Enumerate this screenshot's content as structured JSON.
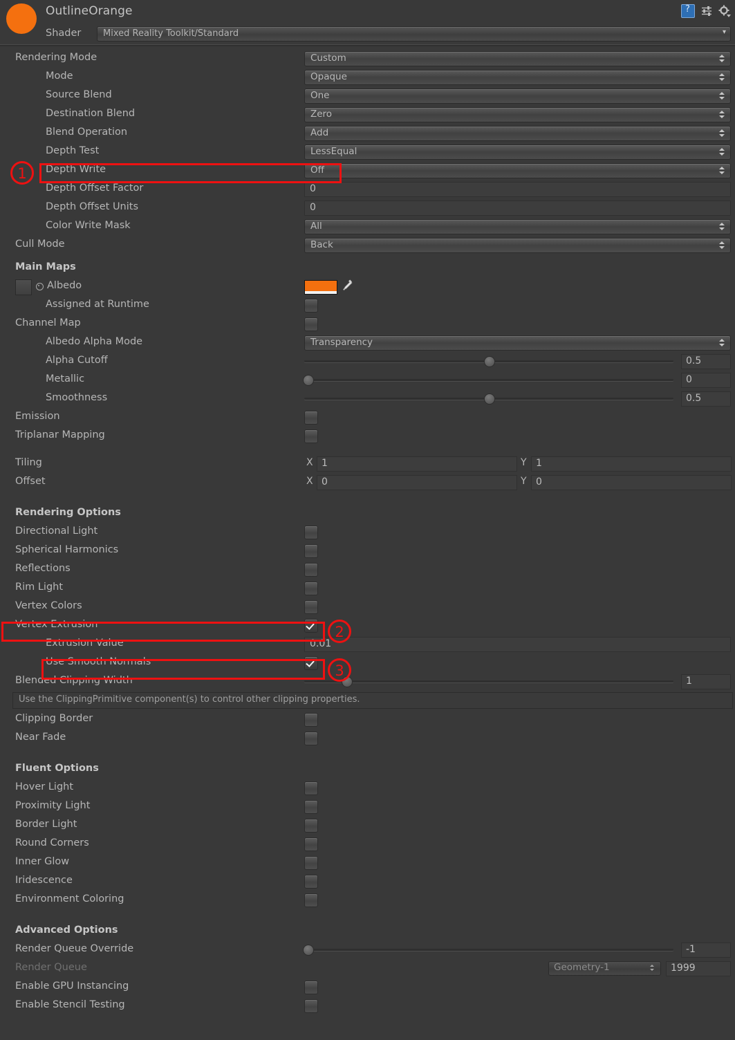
{
  "header": {
    "material_name": "OutlineOrange",
    "material_color": "#f4700f",
    "shader_label": "Shader",
    "shader_value": "Mixed Reality Toolkit/Standard",
    "icons": [
      "help-book-icon",
      "preset-icon",
      "gear-icon"
    ]
  },
  "rendering": {
    "rows": [
      {
        "label": "Rendering Mode",
        "value": "Custom"
      },
      {
        "label": "Mode",
        "value": "Opaque"
      },
      {
        "label": "Source Blend",
        "value": "One"
      },
      {
        "label": "Destination Blend",
        "value": "Zero"
      },
      {
        "label": "Blend Operation",
        "value": "Add"
      },
      {
        "label": "Depth Test",
        "value": "LessEqual"
      },
      {
        "label": "Depth Write",
        "value": "Off"
      },
      {
        "label": "Depth Offset Factor",
        "value": "0"
      },
      {
        "label": "Depth Offset Units",
        "value": "0"
      },
      {
        "label": "Color Write Mask",
        "value": "All"
      },
      {
        "label": "Cull Mode",
        "value": "Back"
      }
    ]
  },
  "main_maps": {
    "title": "Main Maps",
    "albedo_label": "Albedo",
    "albedo_color": "#f4700f",
    "assigned_at_runtime_label": "Assigned at Runtime",
    "assigned_at_runtime_checked": false,
    "channel_map_label": "Channel Map",
    "channel_map_checked": false,
    "albedo_alpha_mode_label": "Albedo Alpha Mode",
    "albedo_alpha_mode_value": "Transparency",
    "alpha_cutoff_label": "Alpha Cutoff",
    "alpha_cutoff_value": "0.5",
    "metallic_label": "Metallic",
    "metallic_value": "0",
    "smoothness_label": "Smoothness",
    "smoothness_value": "0.5",
    "emission_label": "Emission",
    "emission_checked": false,
    "triplanar_label": "Triplanar Mapping",
    "triplanar_checked": false,
    "tiling_label": "Tiling",
    "tiling_x": "1",
    "tiling_y": "1",
    "offset_label": "Offset",
    "offset_x": "0",
    "offset_y": "0",
    "axis_x": "X",
    "axis_y": "Y"
  },
  "rendering_options": {
    "title": "Rendering Options",
    "toggles": [
      {
        "label": "Directional Light",
        "checked": false
      },
      {
        "label": "Spherical Harmonics",
        "checked": false
      },
      {
        "label": "Reflections",
        "checked": false
      },
      {
        "label": "Rim Light",
        "checked": false
      },
      {
        "label": "Vertex Colors",
        "checked": false
      },
      {
        "label": "Vertex Extrusion",
        "checked": true
      }
    ],
    "extrusion_value_label": "Extrusion Value",
    "extrusion_value": "0.01",
    "use_smooth_normals_label": "Use Smooth Normals",
    "use_smooth_normals_checked": true,
    "blended_clipping_width_label": "Blended Clipping Width",
    "blended_clipping_width_value": "1",
    "help_text": "Use the ClippingPrimitive component(s) to control other clipping properties.",
    "clipping_border_label": "Clipping Border",
    "clipping_border_checked": false,
    "near_fade_label": "Near Fade",
    "near_fade_checked": false
  },
  "fluent_options": {
    "title": "Fluent Options",
    "toggles": [
      {
        "label": "Hover Light",
        "checked": false
      },
      {
        "label": "Proximity Light",
        "checked": false
      },
      {
        "label": "Border Light",
        "checked": false
      },
      {
        "label": "Round Corners",
        "checked": false
      },
      {
        "label": "Inner Glow",
        "checked": false
      },
      {
        "label": "Iridescence",
        "checked": false
      },
      {
        "label": "Environment Coloring",
        "checked": false
      }
    ]
  },
  "advanced_options": {
    "title": "Advanced Options",
    "render_queue_override_label": "Render Queue Override",
    "render_queue_override_value": "-1",
    "render_queue_label": "Render Queue",
    "render_queue_preset": "Geometry-1",
    "render_queue_number": "1999",
    "gpu_instancing_label": "Enable GPU Instancing",
    "gpu_instancing_checked": false,
    "stencil_testing_label": "Enable Stencil Testing",
    "stencil_testing_checked": false
  },
  "annotations": {
    "marker_1": "1",
    "marker_2": "2",
    "marker_3": "3",
    "color": "#ee1111"
  }
}
